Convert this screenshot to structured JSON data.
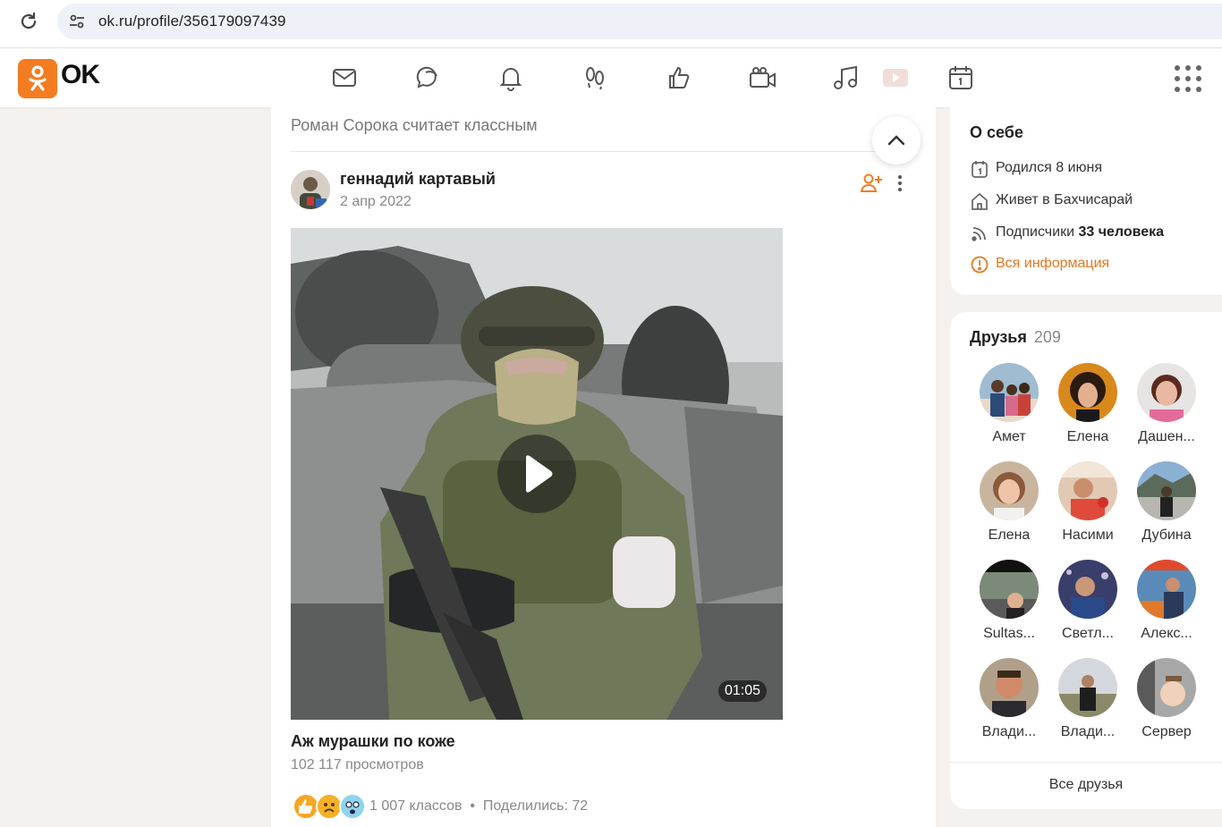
{
  "browser": {
    "url": "ok.ru/profile/356179097439"
  },
  "header": {
    "logo_text": "OK",
    "brand_color": "#f47c20",
    "nav_icons": [
      "messages-icon",
      "discussions-icon",
      "notifications-icon",
      "guests-icon",
      "likes-icon",
      "video-call-icon",
      "music-icon",
      "video-icon",
      "events-icon"
    ]
  },
  "feed": {
    "header_text": "Роман Сорока считает классным",
    "author": "геннадий картавый",
    "date": "2 апр 2022",
    "video": {
      "duration": "01:05",
      "title": "Аж мурашки по коже",
      "views": "102 117 просмотров"
    },
    "reactions_text": "1 007 классов  •  Поделились: 72"
  },
  "about": {
    "title": "О себе",
    "born": "Родился 8 июня",
    "lives": "Живет в Бахчисарай",
    "subscribers_label": "Подписчики",
    "subscribers_value": "33 человека",
    "all_info": "Вся информация"
  },
  "friends": {
    "title": "Друзья",
    "count": "209",
    "items": [
      {
        "name": "Амет"
      },
      {
        "name": "Елена"
      },
      {
        "name": "Дашен..."
      },
      {
        "name": "Елена"
      },
      {
        "name": "Насими"
      },
      {
        "name": "Дубина"
      },
      {
        "name": "Sultas..."
      },
      {
        "name": "Светл..."
      },
      {
        "name": "Алекс..."
      },
      {
        "name": "Влади..."
      },
      {
        "name": "Влади..."
      },
      {
        "name": "Сервер"
      }
    ],
    "all_label": "Все друзья"
  }
}
